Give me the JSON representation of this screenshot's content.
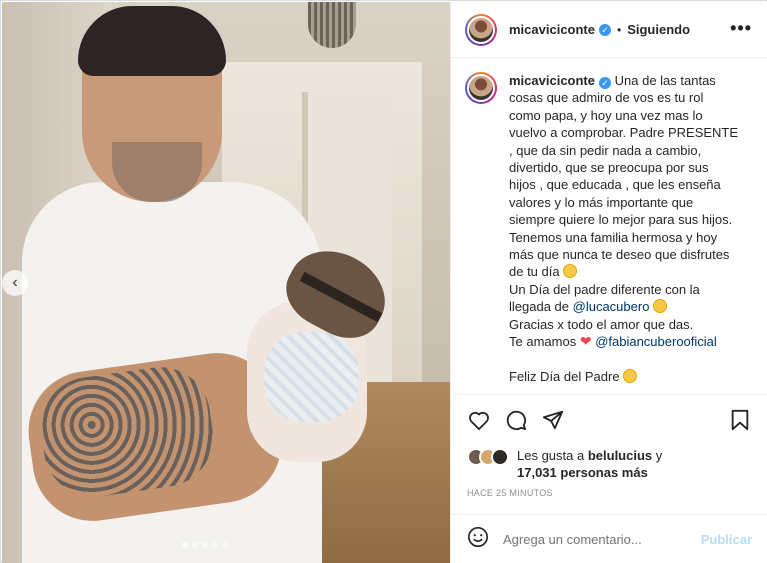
{
  "post": {
    "username": "micaviciconte",
    "separator": "•",
    "follow_status": "Siguiendo",
    "more_label": "•••",
    "caption_lines": [
      "Una de las tantas",
      "cosas que admiro de vos es tu rol",
      "como papa, y hoy una vez mas lo",
      "vuelvo a comprobar. Padre PRESENTE",
      ", que da sin pedir nada a cambio,",
      "divertido, que se preocupa por sus",
      "hijos , que educada , que les enseña",
      "valores y lo más importante que",
      "siempre quiere lo mejor para sus hijos.",
      "Tenemos una familia hermosa y hoy",
      "más que nunca te deseo que disfrutes",
      "de tu día"
    ],
    "line_dia_padre": "Un Día del padre diferente con la",
    "line_llegada_prefix": "llegada de",
    "mention_luca": "@lucacubero",
    "line_gracias": "Gracias x todo el amor que das.",
    "line_te_amamos": "Te amamos",
    "mention_fabian": "@fabiancuberooficial",
    "line_feliz": "Feliz Día del Padre",
    "likes_prefix": "Les gusta a",
    "likes_user": "belulucius",
    "likes_and": "y",
    "likes_count": "17,031 personas más",
    "timestamp": "HACE 25 MINUTOS",
    "comment_placeholder": "Agrega un comentario...",
    "publish_label": "Publicar",
    "nav_prev": "‹"
  },
  "icons": {
    "verified": "verified-badge-icon",
    "like": "heart-outline-icon",
    "comment": "comment-bubble-icon",
    "share": "paper-plane-icon",
    "save": "bookmark-icon",
    "emoji": "smiley-face-icon"
  },
  "colors": {
    "verified": "#3897f0",
    "mention": "#00376b",
    "heart": "#ed4956",
    "publish": "#b2dffc"
  }
}
